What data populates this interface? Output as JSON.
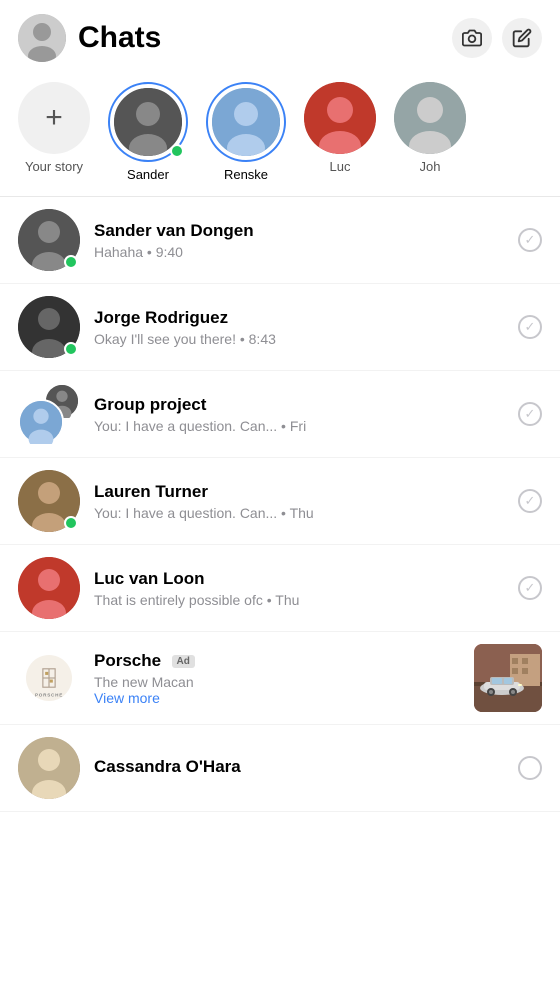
{
  "header": {
    "title": "Chats",
    "camera_label": "camera",
    "edit_label": "edit"
  },
  "stories": {
    "add_label": "Your story",
    "items": [
      {
        "id": "sander",
        "name": "Sander",
        "online": true,
        "ring": true
      },
      {
        "id": "renske",
        "name": "Renske",
        "online": false,
        "ring": true
      },
      {
        "id": "luc",
        "name": "Luc",
        "online": false,
        "ring": false
      },
      {
        "id": "joh",
        "name": "Joh",
        "online": false,
        "ring": false
      }
    ]
  },
  "chats": [
    {
      "id": "sander",
      "name": "Sander van Dongen",
      "preview": "Hahaha • 9:40",
      "online": true,
      "type": "person",
      "avatarClass": "av-sander-chat"
    },
    {
      "id": "jorge",
      "name": "Jorge Rodriguez",
      "preview": "Okay I'll see you there! • 8:43",
      "online": true,
      "type": "person",
      "avatarClass": "av-jorge"
    },
    {
      "id": "group",
      "name": "Group project",
      "preview": "You: I have a question. Can... • Fri",
      "online": false,
      "type": "group"
    },
    {
      "id": "lauren",
      "name": "Lauren Turner",
      "preview": "You: I have a question. Can... • Thu",
      "online": true,
      "type": "person",
      "avatarClass": "av-lauren"
    },
    {
      "id": "luc",
      "name": "Luc van Loon",
      "preview": "That is entirely possible ofc • Thu",
      "online": false,
      "type": "person",
      "avatarClass": "av-luc-chat"
    },
    {
      "id": "porsche",
      "name": "Porsche",
      "ad": true,
      "preview": "The new Macan",
      "viewMore": "View more",
      "type": "ad"
    },
    {
      "id": "cassandra",
      "name": "Cassandra O'Hara",
      "preview": "",
      "online": false,
      "type": "person",
      "avatarClass": "av-cassandra"
    }
  ]
}
